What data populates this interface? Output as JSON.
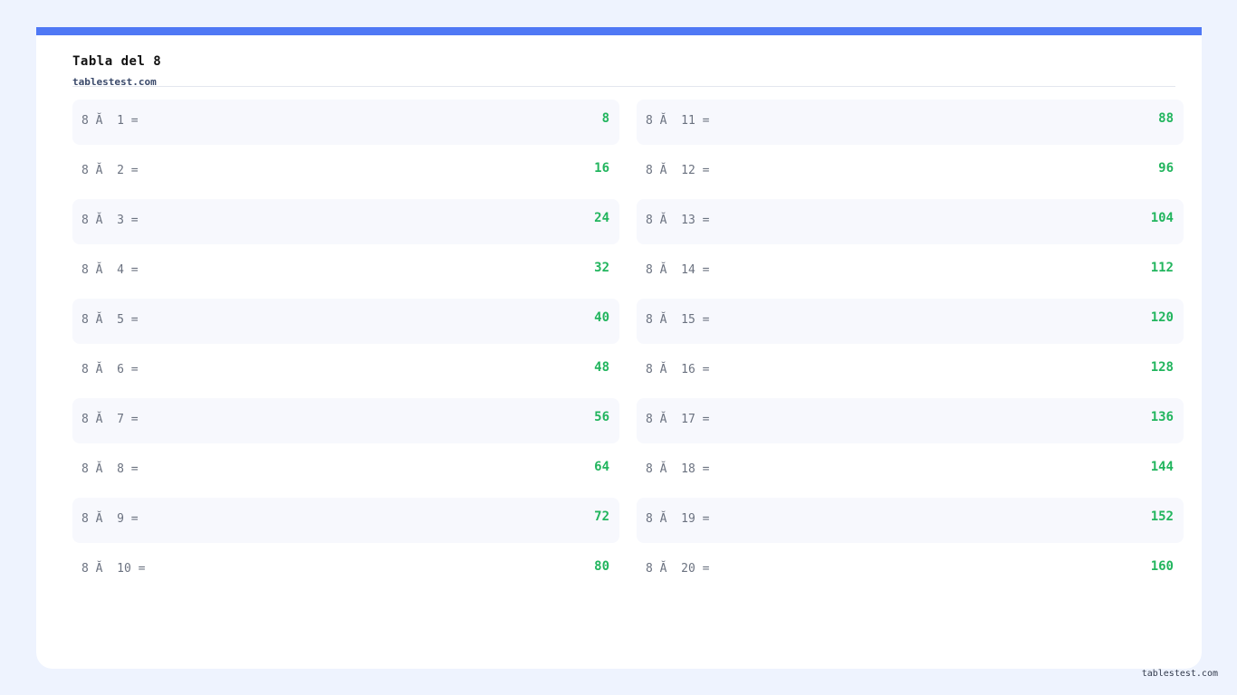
{
  "page": {
    "title": "Tabla del 8",
    "subtitle": "tablestest.com",
    "footer": "tablestest.com"
  },
  "colors": {
    "background": "#eef3fe",
    "accent": "#4f78f5",
    "result": "#22b55e",
    "row_shade": "#f7f8fd"
  },
  "left_rows": [
    {
      "expr": "8 Ă  1 =",
      "result": "8"
    },
    {
      "expr": "8 Ă  2 =",
      "result": "16"
    },
    {
      "expr": "8 Ă  3 =",
      "result": "24"
    },
    {
      "expr": "8 Ă  4 =",
      "result": "32"
    },
    {
      "expr": "8 Ă  5 =",
      "result": "40"
    },
    {
      "expr": "8 Ă  6 =",
      "result": "48"
    },
    {
      "expr": "8 Ă  7 =",
      "result": "56"
    },
    {
      "expr": "8 Ă  8 =",
      "result": "64"
    },
    {
      "expr": "8 Ă  9 =",
      "result": "72"
    },
    {
      "expr": "8 Ă  10 =",
      "result": "80"
    }
  ],
  "right_rows": [
    {
      "expr": "8 Ă  11 =",
      "result": "88"
    },
    {
      "expr": "8 Ă  12 =",
      "result": "96"
    },
    {
      "expr": "8 Ă  13 =",
      "result": "104"
    },
    {
      "expr": "8 Ă  14 =",
      "result": "112"
    },
    {
      "expr": "8 Ă  15 =",
      "result": "120"
    },
    {
      "expr": "8 Ă  16 =",
      "result": "128"
    },
    {
      "expr": "8 Ă  17 =",
      "result": "136"
    },
    {
      "expr": "8 Ă  18 =",
      "result": "144"
    },
    {
      "expr": "8 Ă  19 =",
      "result": "152"
    },
    {
      "expr": "8 Ă  20 =",
      "result": "160"
    }
  ]
}
